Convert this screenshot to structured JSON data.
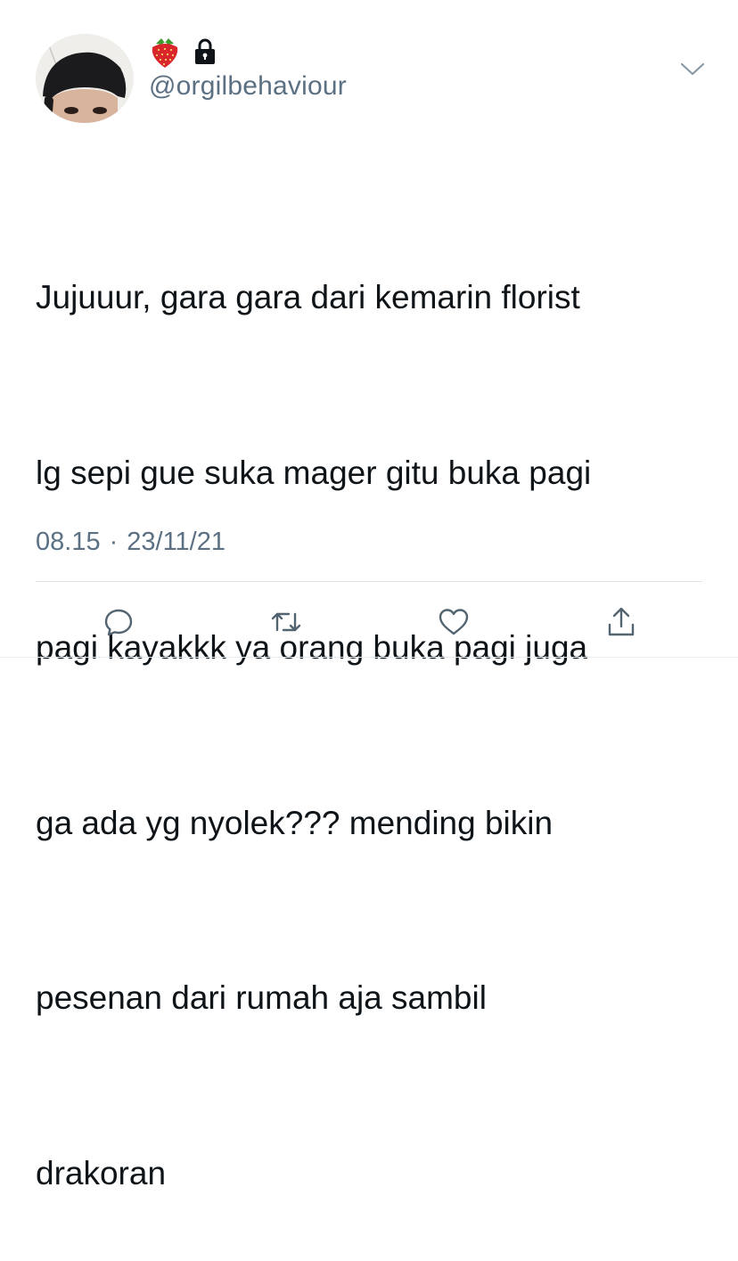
{
  "user": {
    "handle": "@orgilbehaviour",
    "name_emoji": "strawberry-icon",
    "protected_icon": "lock-icon"
  },
  "tweet": {
    "lines": [
      "Jujuuur, gara gara dari kemarin florist",
      "lg sepi gue suka mager gitu buka pagi",
      "pagi kayakkk ya orang buka pagi juga",
      "ga ada yg nyolek??? mending bikin",
      "pesenan dari rumah aja sambil",
      "drakoran"
    ],
    "time": "08.15",
    "separator": "·",
    "date": "23/11/21"
  },
  "actions": [
    "reply-icon",
    "retweet-icon",
    "like-icon",
    "share-icon"
  ],
  "colors": {
    "text": "#0f1419",
    "secondary": "#5b7083",
    "icon": "#536471",
    "divider": "#dfe3e6"
  }
}
